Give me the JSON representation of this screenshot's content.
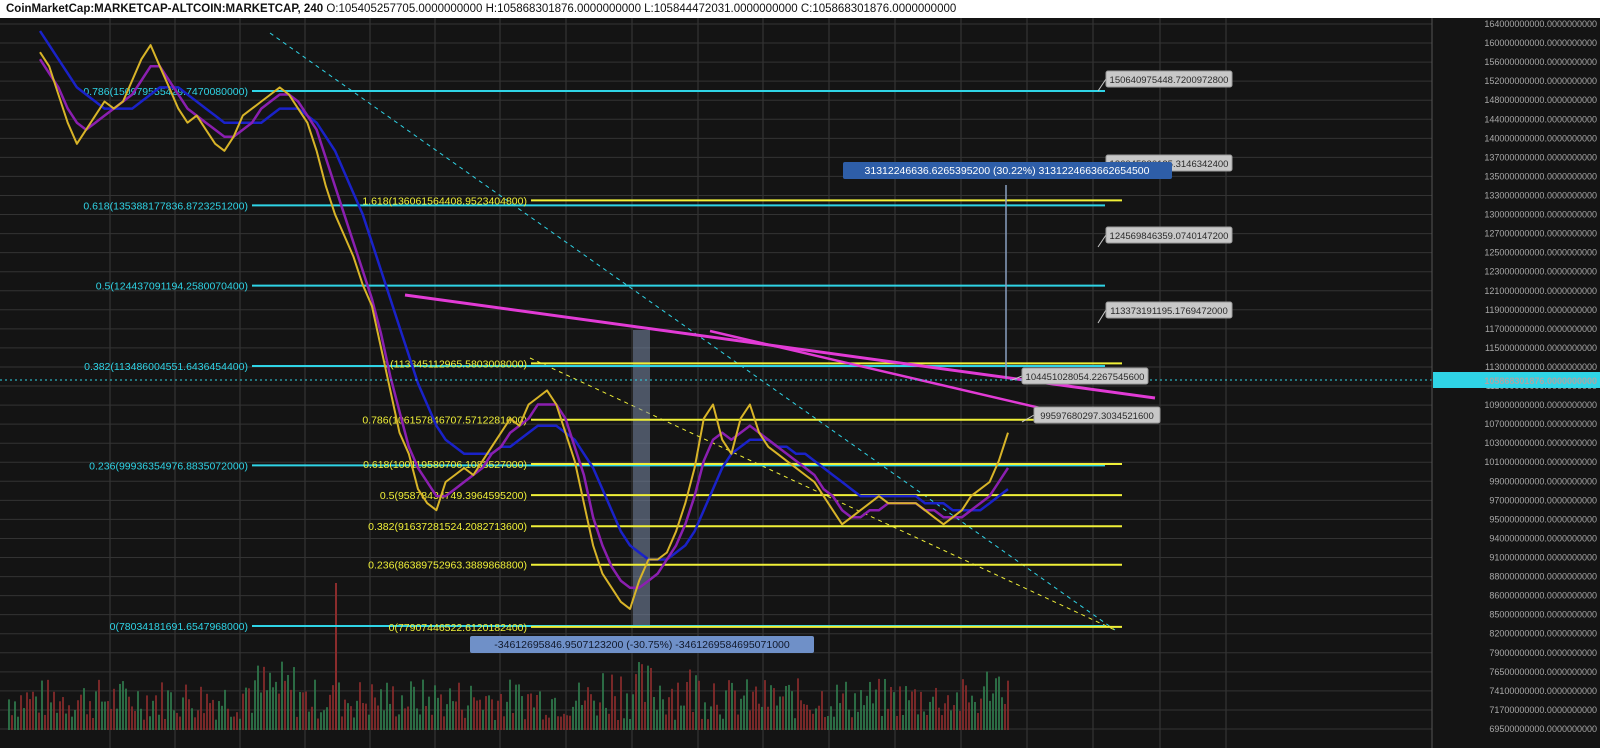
{
  "header": {
    "symbol": "CoinMarketCap:MARKETCAP-ALTCOIN:MARKETCAP, 240",
    "ohlc": "O:105405257705.0000000000 H:105868301876.0000000000 L:105844472031.0000000000 C:105868301876.0000000000"
  },
  "colors": {
    "background": "#141414",
    "fib_cyan": "#2fd4e6",
    "fib_yellow": "#f0f038",
    "trendline": "#e23bd6",
    "ma_blue": "#1a22c8",
    "ma_purple": "#8b1fb0",
    "price": "#d8b428",
    "vol_up": "#2f7a4c",
    "vol_down": "#8a2c2c"
  },
  "chart_data": {
    "type": "line",
    "title": "CoinMarketCap:MARKETCAP-ALTCOIN:MARKETCAP, 240",
    "price_tag": "105868301876.0000000000",
    "y_ticks": [
      "164000000000.0000000000",
      "160000000000.0000000000",
      "156000000000.0000000000",
      "152000000000.0000000000",
      "148000000000.0000000000",
      "144000000000.0000000000",
      "140000000000.0000000000",
      "137000000000.0000000000",
      "135000000000.0000000000",
      "133000000000.0000000000",
      "130000000000.0000000000",
      "127000000000.0000000000",
      "125000000000.0000000000",
      "123000000000.0000000000",
      "121000000000.0000000000",
      "119000000000.0000000000",
      "117000000000.0000000000",
      "115000000000.0000000000",
      "113000000000.0000000000",
      "111000000000.0000000000",
      "109000000000.0000000000",
      "107000000000.0000000000",
      "103000000000.0000000000",
      "101000000000.0000000000",
      "99000000000.0000000000",
      "97000000000.0000000000",
      "95000000000.0000000000",
      "94000000000.0000000000",
      "91000000000.0000000000",
      "88000000000.0000000000",
      "86000000000.0000000000",
      "85000000000.0000000000",
      "82000000000.0000000000",
      "79000000000.0000000000",
      "76500000000.0000000000",
      "74100000000.0000000000",
      "71700000000.0000000000",
      "69500000000.0000000000"
    ],
    "fib_cyan": [
      {
        "label": "0.786(150979555429.7470080000)",
        "value": 150979555429.747
      },
      {
        "label": "0.618(135388177836.8723251200)",
        "value": 135388177836.872
      },
      {
        "label": "0.5(124437091194.2580070400)",
        "value": 124437091194.258
      },
      {
        "label": "0.382(113486004551.6436454400)",
        "value": 113486004551.644
      },
      {
        "label": "0.236(99936354976.8835072000)",
        "value": 99936354976.8835
      },
      {
        "label": "0(78034181691.6547968000)",
        "value": 78034181691.6548
      }
    ],
    "fib_yellow": [
      {
        "label": "1.618(136061564408.9523404800)",
        "value": 136061564408.952
      },
      {
        "label": "1(113845112965.5803008000)",
        "value": 113845112965.58
      },
      {
        "label": "0.786(106157846707.5712281600)",
        "value": 106157846707.571
      },
      {
        "label": "0.618(100119580706.1083527000)",
        "value": 100119580706.108
      },
      {
        "label": "0.5(95878434749.3964595200)",
        "value": 95878434749.3965
      },
      {
        "label": "0.382(91637281524.2082713600)",
        "value": 91637281524.2083
      },
      {
        "label": "0.236(86389752963.3889868800)",
        "value": 86389752963.389
      },
      {
        "label": "0(77907446522.6120182400)",
        "value": 77907446522.612
      }
    ],
    "callouts_gray": [
      "150640975448.7200972800",
      "136045920125.3146342400",
      "124569846359.0740147200",
      "113373191195.1769472000",
      "104451028054.2267545600",
      "99597680297.3034521600"
    ],
    "measure_up": "31312246636.6265395200 (30.22%) 3131224663662654500",
    "measure_down": "-34612695846.9507123200 (-30.75%) -3461269584695071000",
    "series": [
      {
        "name": "price",
        "values": [
          160,
          158,
          154,
          150,
          147,
          149,
          151,
          153,
          152,
          153,
          156,
          159,
          161,
          158,
          155,
          152,
          150,
          151,
          149,
          147,
          146,
          148,
          151,
          152,
          153,
          154,
          155,
          154,
          152,
          150,
          146,
          141,
          137,
          134,
          131,
          127,
          124,
          118,
          112,
          106,
          103,
          98,
          96,
          95,
          99,
          100,
          101,
          100,
          102,
          104,
          106,
          108,
          107,
          110,
          111,
          112,
          110,
          106,
          102,
          96,
          90,
          86,
          84,
          82,
          81,
          85,
          88,
          88,
          89,
          92,
          96,
          101,
          108,
          110,
          105,
          103,
          108,
          110,
          106,
          104,
          103,
          102,
          101,
          100,
          99,
          97,
          95,
          93,
          94,
          95,
          96,
          97,
          96,
          96,
          96,
          96,
          95,
          94,
          93,
          94,
          95,
          97,
          98,
          99,
          102,
          106
        ]
      },
      {
        "name": "ma-fast",
        "values": [
          159,
          157,
          155,
          152,
          150,
          149,
          150,
          151,
          152,
          153,
          154,
          156,
          158,
          158,
          156,
          154,
          152,
          151,
          150,
          149,
          148,
          148,
          149,
          150,
          152,
          153,
          154,
          154,
          153,
          151,
          149,
          145,
          141,
          137,
          133,
          129,
          125,
          120,
          114,
          109,
          104,
          101,
          99,
          97,
          97,
          98,
          99,
          100,
          101,
          103,
          104,
          106,
          107,
          108,
          110,
          110,
          110,
          108,
          104,
          100,
          94,
          90,
          87,
          85,
          84,
          84,
          85,
          86,
          88,
          90,
          93,
          97,
          102,
          105,
          106,
          105,
          106,
          107,
          106,
          105,
          104,
          103,
          102,
          101,
          100,
          98,
          97,
          95,
          94,
          94,
          95,
          95,
          96,
          96,
          96,
          96,
          95,
          95,
          94,
          94,
          94,
          95,
          96,
          97,
          99,
          101
        ]
      },
      {
        "name": "ma-slow",
        "values": [
          163,
          161,
          159,
          157,
          155,
          154,
          153,
          152,
          152,
          152,
          152,
          153,
          154,
          155,
          155,
          155,
          154,
          153,
          152,
          151,
          150,
          150,
          150,
          150,
          150,
          151,
          152,
          152,
          152,
          151,
          150,
          148,
          146,
          143,
          140,
          137,
          133,
          129,
          125,
          121,
          117,
          113,
          110,
          107,
          105,
          104,
          103,
          103,
          103,
          103,
          104,
          104,
          105,
          106,
          107,
          107,
          107,
          106,
          105,
          103,
          101,
          98,
          95,
          92,
          90,
          89,
          88,
          88,
          88,
          89,
          90,
          92,
          95,
          98,
          101,
          103,
          104,
          105,
          105,
          105,
          104,
          104,
          103,
          103,
          102,
          101,
          100,
          99,
          98,
          97,
          97,
          97,
          97,
          97,
          97,
          97,
          96,
          96,
          96,
          95,
          95,
          95,
          95,
          96,
          97,
          98
        ]
      }
    ]
  }
}
